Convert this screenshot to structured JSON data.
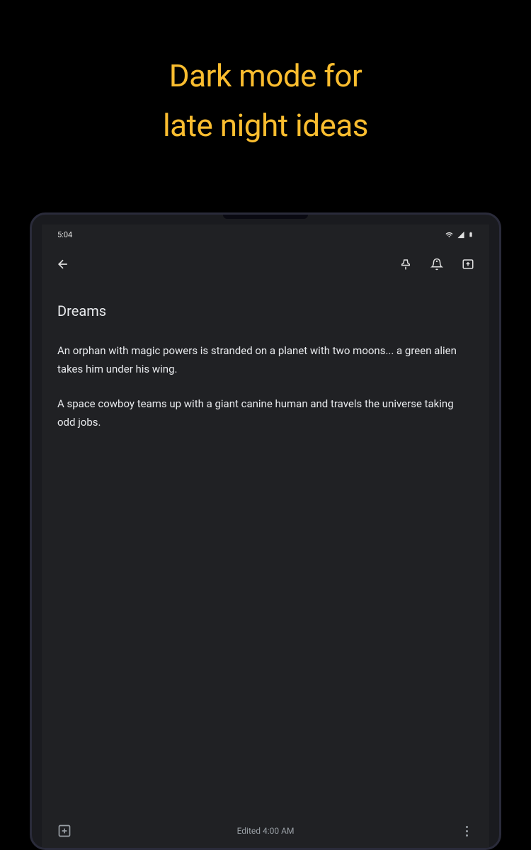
{
  "promo": {
    "line1": "Dark mode for",
    "line2": "late night ideas"
  },
  "statusBar": {
    "time": "5:04"
  },
  "note": {
    "title": "Dreams",
    "paragraph1": "An orphan with magic powers is stranded on a planet with two moons... a green alien takes him under his wing.",
    "paragraph2": "A space cowboy teams up with a giant canine human and travels the universe taking odd jobs."
  },
  "footer": {
    "editedLabel": "Edited 4:00 AM"
  }
}
